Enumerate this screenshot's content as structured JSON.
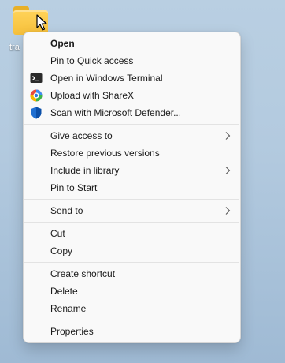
{
  "desktop": {
    "icon_label": "tra"
  },
  "context_menu": {
    "groups": [
      [
        {
          "label": "Open",
          "bold": true
        },
        {
          "label": "Pin to Quick access"
        },
        {
          "label": "Open in Windows Terminal",
          "icon": "terminal-icon"
        },
        {
          "label": "Upload with ShareX",
          "icon": "sharex-icon"
        },
        {
          "label": "Scan with Microsoft Defender...",
          "icon": "defender-shield-icon"
        }
      ],
      [
        {
          "label": "Give access to",
          "submenu": true
        },
        {
          "label": "Restore previous versions"
        },
        {
          "label": "Include in library",
          "submenu": true
        },
        {
          "label": "Pin to Start"
        }
      ],
      [
        {
          "label": "Send to",
          "submenu": true
        }
      ],
      [
        {
          "label": "Cut"
        },
        {
          "label": "Copy"
        }
      ],
      [
        {
          "label": "Create shortcut"
        },
        {
          "label": "Delete"
        },
        {
          "label": "Rename"
        }
      ],
      [
        {
          "label": "Properties"
        }
      ]
    ]
  },
  "colors": {
    "desktop_background": "#b3cadf",
    "menu_background": "#f9f9f9",
    "separator": "#e3e3e3",
    "text": "#1a1a1a"
  }
}
